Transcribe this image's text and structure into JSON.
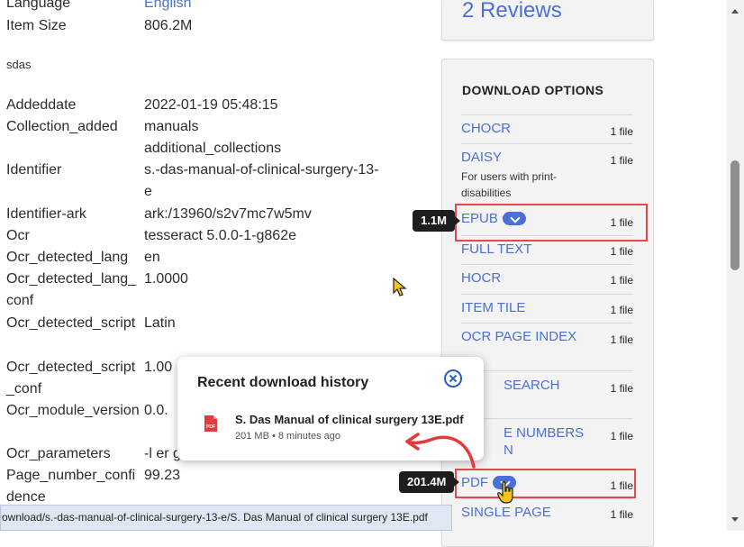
{
  "metadata": {
    "rows": [
      {
        "key": "Language",
        "value": "English"
      },
      {
        "key": "Item Size",
        "value": "806.2M"
      },
      {
        "key": "Addeddate",
        "value": "2022-01-19 05:48:15"
      },
      {
        "key": "Collection_added",
        "value": "manuals"
      },
      {
        "key": "",
        "value": "additional_collections"
      },
      {
        "key": "Identifier",
        "value": "s.-das-manual-of-clinical-surgery-13-e"
      },
      {
        "key": "Identifier-ark",
        "value": "ark:/13960/s2v7mc7w5mv"
      },
      {
        "key": "Ocr",
        "value": "tesseract 5.0.0-1-g862e"
      },
      {
        "key": "Ocr_detected_lang",
        "value": "en"
      },
      {
        "key": "Ocr_detected_lang_conf",
        "value": "1.0000"
      },
      {
        "key": "Ocr_detected_script",
        "value": "Latin"
      },
      {
        "key": "Ocr_detected_script_conf",
        "value": "1.00"
      },
      {
        "key": "Ocr_module_version",
        "value": "0.0."
      },
      {
        "key": "Ocr_parameters",
        "value": "-l er g"
      },
      {
        "key": "Page_number_confidence",
        "value": "99.23"
      }
    ],
    "description": "sdas"
  },
  "reviews": {
    "label": "2 Reviews"
  },
  "download_options": {
    "title": "DOWNLOAD OPTIONS",
    "items": [
      {
        "name": "CHOCR",
        "count": "1 file"
      },
      {
        "name": "DAISY",
        "count": "1 file",
        "sub": "For users with print-disabilities"
      },
      {
        "name": "EPUB",
        "count": "1 file"
      },
      {
        "name": "FULL TEXT",
        "count": "1 file"
      },
      {
        "name": "HOCR",
        "count": "1 file"
      },
      {
        "name": "ITEM TILE",
        "count": "1 file"
      },
      {
        "name": "OCR PAGE INDEX",
        "count": "1 file"
      },
      {
        "name": "SEARCH",
        "count": "1 file"
      },
      {
        "name": "E NUMBERS",
        "count": "1 file",
        "sub": "N"
      },
      {
        "name": "PDF",
        "count": "1 file"
      },
      {
        "name": "SINGLE PAGE",
        "count": "1 file"
      }
    ]
  },
  "tooltips": {
    "epub": "1.1M",
    "pdf": "201.4M"
  },
  "history": {
    "title": "Recent download history",
    "file_name": "S. Das Manual of clinical surgery 13E.pdf",
    "file_meta": "201 MB • 8 minutes ago",
    "file_icon_label": "PDF"
  },
  "status_bar": {
    "url": "ownload/s.-das-manual-of-clinical-surgery-13-e/S. Das Manual of clinical surgery 13E.pdf"
  },
  "colors": {
    "link": "#4a6fd6",
    "highlight": "#e24a4a",
    "panel": "#f3f3f3"
  }
}
